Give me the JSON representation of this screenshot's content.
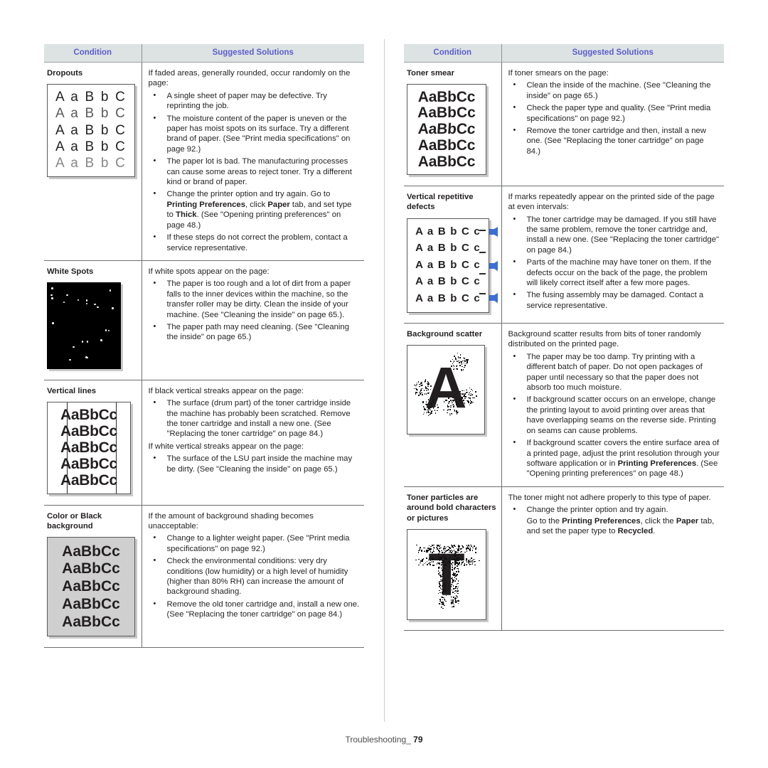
{
  "page": {
    "footer_label": "Troubleshooting_",
    "footer_page_number": "79",
    "header_bg": "#dde3e3",
    "header_text_color": "#5c5ccc",
    "divider_color": "#c5c8e8",
    "arrow_color": "#3b6fd4"
  },
  "headers": {
    "condition": "Condition",
    "solutions": "Suggested Solutions"
  },
  "left_column": {
    "rows": [
      {
        "condition": "Dropouts",
        "sample": "dropouts-sample-image",
        "intro": "If faded areas, generally rounded, occur randomly on the page:",
        "bullets": [
          "A single sheet of paper may be defective. Try reprinting the job.",
          "The moisture content of the paper is uneven or the paper has moist spots on its surface. Try a different brand of paper. (See \"Print media specifications\" on page 92.)",
          "The paper lot is bad. The manufacturing processes can cause some areas to reject toner. Try a different kind or brand of paper.",
          "Change the printer option and try again. Go to Printing Preferences, click Paper tab, and set type to Thick. (See \"Opening printing preferences\" on page 48.)",
          "If these steps do not correct the problem, contact a service representative."
        ]
      },
      {
        "condition": "White Spots",
        "sample": "white-spots-sample-image",
        "intro": "If white spots appear on the page:",
        "bullets": [
          "The paper is too rough and a lot of dirt from a paper falls to the inner devices within the machine, so the transfer roller may be dirty. Clean the inside of your machine. (See \"Cleaning the inside\" on page 65.).",
          "The paper path may need cleaning. (See \"Cleaning the inside\" on page 65.)"
        ]
      },
      {
        "condition": "Vertical lines",
        "sample": "vertical-lines-sample-image",
        "intro": "If black vertical streaks appear on the page:",
        "bullets": [
          "The surface (drum part) of the toner cartridge inside the machine has probably been scratched. Remove the toner cartridge and install a new one. (See \"Replacing the toner cartridge\" on page 84.)"
        ],
        "mid_intro": "If white vertical streaks appear on the page:",
        "bullets2": [
          "The surface of the LSU part inside the machine may be dirty. (See \"Cleaning the inside\" on page 65.)"
        ]
      },
      {
        "condition": "Color or Black background",
        "sample": "gray-background-sample-image",
        "intro": "If the amount of background shading becomes unacceptable:",
        "bullets": [
          "Change to a lighter weight paper. (See \"Print media specifications\" on page 92.)",
          "Check the environmental conditions: very dry conditions (low humidity) or a high level of humidity (higher than 80% RH) can increase the amount of background shading.",
          "Remove the old toner cartridge and, install a new one. (See \"Replacing the toner cartridge\" on page 84.)"
        ]
      }
    ]
  },
  "right_column": {
    "rows": [
      {
        "condition": "Toner smear",
        "sample": "toner-smear-sample-image",
        "intro": "If toner smears on the page:",
        "bullets": [
          "Clean the inside of the machine. (See \"Cleaning the inside\" on page 65.)",
          "Check the paper type and quality. (See \"Print media specifications\" on page 92.)",
          "Remove the toner cartridge and then, install a new one. (See \"Replacing the toner cartridge\" on page 84.)"
        ]
      },
      {
        "condition": "Vertical repetitive defects",
        "sample": "vertical-repetitive-defects-sample-image",
        "intro": "If marks repeatedly appear on the printed side of the page at even intervals:",
        "bullets": [
          "The toner cartridge may be damaged. If you still have the same problem, remove the toner cartridge and, install a new one. (See \"Replacing the toner cartridge\" on page 84.)",
          "Parts of the machine may have toner on them. If the defects occur on the back of the page, the problem will likely correct itself after a few more pages.",
          "The fusing assembly may be damaged. Contact a service representative."
        ]
      },
      {
        "condition": "Background scatter",
        "sample": "background-scatter-sample-image",
        "intro": "Background scatter results from bits of toner randomly distributed on the printed page.",
        "bullets": [
          "The paper may be too damp. Try printing with a different batch of paper. Do not open packages of paper until necessary so that the paper does not absorb too much moisture.",
          "If background scatter occurs on an envelope, change the printing layout to avoid printing over areas that have overlapping seams on the reverse side. Printing on seams can cause problems.",
          "If background scatter covers the entire surface area of a printed page, adjust the print resolution through your software application or in Printing Preferences. (See \"Opening printing preferences\" on page 48.)"
        ]
      },
      {
        "condition": "Toner particles are around bold characters or pictures",
        "sample": "toner-particles-sample-image",
        "intro": "The toner might not adhere properly to this type of paper.",
        "bullets": [
          "Change the printer option and try again.",
          "Go to the Printing Preferences, click the Paper tab, and set the paper type to Recycled."
        ]
      }
    ]
  },
  "samples": {
    "dropouts_lines": [
      "A a B b C",
      "A a B b C",
      "A a B b C",
      "A a B b C",
      "A a B b C"
    ],
    "vertical_lines_text": [
      "AaBbCc",
      "AaBbCc",
      "AaBbCc",
      "AaBbCc",
      "AaBbCc"
    ],
    "gray_bg_text": [
      "AaBbCc",
      "AaBbCc",
      "AaBbCc",
      "AaBbCc",
      "AaBbCc"
    ],
    "toner_smear_text": [
      "AaBbCc",
      "AaBbCc",
      "AaBbCc",
      "AaBbCc",
      "AaBbCc"
    ],
    "repetitive_text": [
      "A a B b C c",
      "A a B b C c",
      "A a B b C c",
      "A a B b C c",
      "A a B b C c"
    ],
    "scatter_glyph": "A",
    "particles_glyph": "T"
  }
}
